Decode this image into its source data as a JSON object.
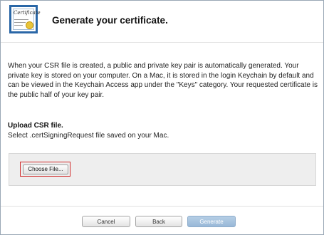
{
  "header": {
    "icon": "certificate-icon",
    "icon_script_text": "Certificate",
    "title": "Generate your certificate."
  },
  "description": "When your CSR file is created, a public and private key pair is automatically generated. Your private key is stored on your computer. On a Mac, it is stored in the login Keychain by default and can be viewed in the Keychain Access app under the \"Keys\" category. Your requested certificate is the public half of your key pair.",
  "upload": {
    "title": "Upload CSR file.",
    "subtitle": "Select .certSigningRequest file saved on your Mac.",
    "choose_file_label": "Choose File...",
    "highlight_color": "#d12c2c"
  },
  "footer": {
    "cancel_label": "Cancel",
    "back_label": "Back",
    "generate_label": "Generate",
    "generate_color": "#98b8d8"
  }
}
